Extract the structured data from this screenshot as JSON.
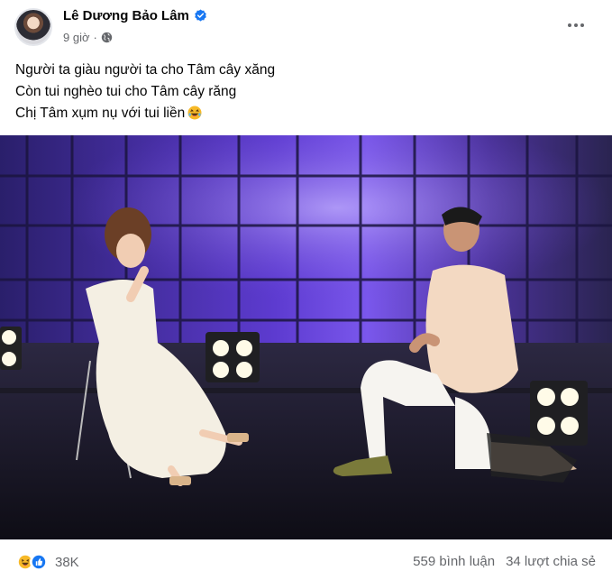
{
  "post": {
    "author": "Lê Dương Bảo Lâm",
    "time": "9 giờ",
    "lines": [
      "Người ta giàu người ta cho Tâm cây xăng",
      "Còn tui nghèo tui cho Tâm cây răng",
      "Chị Tâm xụm nụ với tui liền"
    ]
  },
  "reactions": {
    "count": "38K",
    "comments": "559 bình luận",
    "shares": "34 lượt chia sẻ"
  },
  "icons": {
    "verified": "verified-badge-icon",
    "privacy": "globe-icon",
    "more": "more-options-icon",
    "line_end_emoji": "rolling-laughing-emoji",
    "reaction_1": "haha-reaction-icon",
    "reaction_2": "like-reaction-icon"
  },
  "colors": {
    "brand_blue": "#1877f2",
    "meta_gray": "#65676b",
    "haha_yellow": "#f7b928",
    "stage_purple": "#6a45d8"
  }
}
